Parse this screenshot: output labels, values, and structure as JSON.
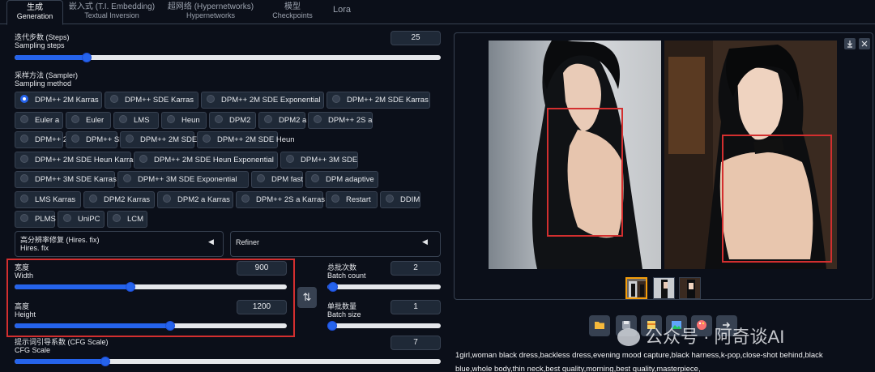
{
  "tabs": [
    {
      "zh": "生成",
      "en": "Generation"
    },
    {
      "zh": "嵌入式 (T.I. Embedding)",
      "en": "Textual Inversion"
    },
    {
      "zh": "超网络 (Hypernetworks)",
      "en": "Hypernetworks"
    },
    {
      "zh": "模型",
      "en": "Checkpoints"
    },
    {
      "zh": "Lora",
      "en": ""
    }
  ],
  "steps": {
    "label_zh": "迭代步数 (Steps)",
    "label_en": "Sampling steps",
    "value": "25",
    "min": 1,
    "max": 150
  },
  "sampler": {
    "label_zh": "采样方法 (Sampler)",
    "label_en": "Sampling method",
    "selected": "DPM++ 2M Karras",
    "rows": [
      [
        "DPM++ 2M Karras",
        "DPM++ SDE Karras",
        "DPM++ 2M SDE Exponential",
        "DPM++ 2M SDE Karras"
      ],
      [
        "Euler a",
        "Euler",
        "LMS",
        "Heun",
        "DPM2",
        "DPM2 a",
        "DPM++ 2S a"
      ],
      [
        "DPM++ 2M",
        "DPM++ SDE",
        "DPM++ 2M SDE",
        "DPM++ 2M SDE Heun"
      ],
      [
        "DPM++ 2M SDE Heun Karras",
        "DPM++ 2M SDE Heun Exponential",
        "DPM++ 3M SDE"
      ],
      [
        "DPM++ 3M SDE Karras",
        "DPM++ 3M SDE Exponential",
        "DPM fast",
        "DPM adaptive"
      ],
      [
        "LMS Karras",
        "DPM2 Karras",
        "DPM2 a Karras",
        "DPM++ 2S a Karras",
        "Restart",
        "DDIM"
      ],
      [
        "PLMS",
        "UniPC",
        "LCM"
      ]
    ]
  },
  "hires": {
    "label_zh": "高分辨率修复 (Hires. fix)",
    "label_en": "Hires. fix",
    "arrow": "◀"
  },
  "refiner": {
    "label": "Refiner",
    "arrow": "◀"
  },
  "width": {
    "label_zh": "宽度",
    "label_en": "Width",
    "value": "900",
    "min": 64,
    "max": 2048
  },
  "height": {
    "label_zh": "高度",
    "label_en": "Height",
    "value": "1200",
    "min": 64,
    "max": 2048
  },
  "swap_icon": "⇅",
  "batch_count": {
    "label_zh": "总批次数",
    "label_en": "Batch count",
    "value": "2",
    "min": 1,
    "max": 100
  },
  "batch_size": {
    "label_zh": "单批数量",
    "label_en": "Batch size",
    "value": "1",
    "min": 1,
    "max": 8
  },
  "cfg": {
    "label_zh": "提示词引导系数 (CFG Scale)",
    "label_en": "CFG Scale",
    "value": "7",
    "min": 1,
    "max": 30
  },
  "gallery": {
    "download_icon": "download-icon",
    "close_icon": "close-icon"
  },
  "toolbar": [
    "folder-icon",
    "save-icon",
    "zip-icon",
    "image-icon",
    "palette-icon",
    "send-icon"
  ],
  "watermark": "公众号 · 阿奇谈AI",
  "prompt": "1girl,woman black dress,backless dress,evening mood capture,black harness,k-pop,close-shot behind,black blue,whole body,thin neck,best quality,morning,best quality,masterpiece,",
  "colors": {
    "accent": "#2563eb",
    "annotation": "#d32f2f",
    "background": "#0b0f19",
    "panel": "#1f2937"
  }
}
